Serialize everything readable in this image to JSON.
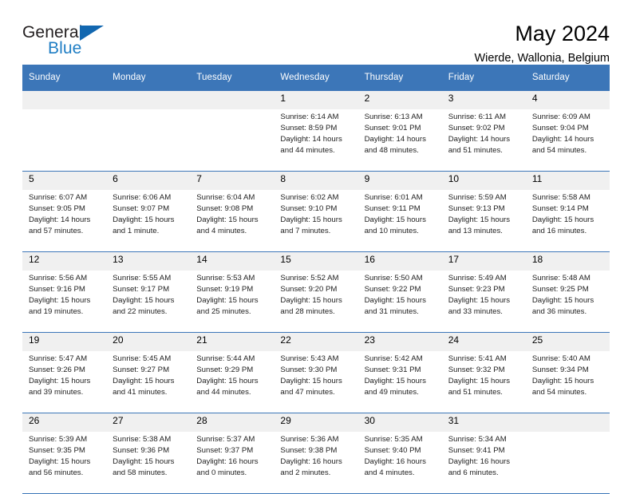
{
  "brand": {
    "name_part1": "General",
    "name_part2": "Blue",
    "logo_icon": "blue-triangle-icon"
  },
  "header": {
    "title": "May 2024",
    "subtitle": "Wierde, Wallonia, Belgium"
  },
  "theme": {
    "header_blue": "#3c76b8",
    "daynum_bg": "#f0f0f0",
    "brand_blue": "#1f7ec4",
    "text": "#000000"
  },
  "weekdays": [
    "Sunday",
    "Monday",
    "Tuesday",
    "Wednesday",
    "Thursday",
    "Friday",
    "Saturday"
  ],
  "weeks": [
    [
      {
        "day": "",
        "lines": []
      },
      {
        "day": "",
        "lines": []
      },
      {
        "day": "",
        "lines": []
      },
      {
        "day": "1",
        "lines": [
          "Sunrise: 6:14 AM",
          "Sunset: 8:59 PM",
          "Daylight: 14 hours",
          "and 44 minutes."
        ]
      },
      {
        "day": "2",
        "lines": [
          "Sunrise: 6:13 AM",
          "Sunset: 9:01 PM",
          "Daylight: 14 hours",
          "and 48 minutes."
        ]
      },
      {
        "day": "3",
        "lines": [
          "Sunrise: 6:11 AM",
          "Sunset: 9:02 PM",
          "Daylight: 14 hours",
          "and 51 minutes."
        ]
      },
      {
        "day": "4",
        "lines": [
          "Sunrise: 6:09 AM",
          "Sunset: 9:04 PM",
          "Daylight: 14 hours",
          "and 54 minutes."
        ]
      }
    ],
    [
      {
        "day": "5",
        "lines": [
          "Sunrise: 6:07 AM",
          "Sunset: 9:05 PM",
          "Daylight: 14 hours",
          "and 57 minutes."
        ]
      },
      {
        "day": "6",
        "lines": [
          "Sunrise: 6:06 AM",
          "Sunset: 9:07 PM",
          "Daylight: 15 hours",
          "and 1 minute."
        ]
      },
      {
        "day": "7",
        "lines": [
          "Sunrise: 6:04 AM",
          "Sunset: 9:08 PM",
          "Daylight: 15 hours",
          "and 4 minutes."
        ]
      },
      {
        "day": "8",
        "lines": [
          "Sunrise: 6:02 AM",
          "Sunset: 9:10 PM",
          "Daylight: 15 hours",
          "and 7 minutes."
        ]
      },
      {
        "day": "9",
        "lines": [
          "Sunrise: 6:01 AM",
          "Sunset: 9:11 PM",
          "Daylight: 15 hours",
          "and 10 minutes."
        ]
      },
      {
        "day": "10",
        "lines": [
          "Sunrise: 5:59 AM",
          "Sunset: 9:13 PM",
          "Daylight: 15 hours",
          "and 13 minutes."
        ]
      },
      {
        "day": "11",
        "lines": [
          "Sunrise: 5:58 AM",
          "Sunset: 9:14 PM",
          "Daylight: 15 hours",
          "and 16 minutes."
        ]
      }
    ],
    [
      {
        "day": "12",
        "lines": [
          "Sunrise: 5:56 AM",
          "Sunset: 9:16 PM",
          "Daylight: 15 hours",
          "and 19 minutes."
        ]
      },
      {
        "day": "13",
        "lines": [
          "Sunrise: 5:55 AM",
          "Sunset: 9:17 PM",
          "Daylight: 15 hours",
          "and 22 minutes."
        ]
      },
      {
        "day": "14",
        "lines": [
          "Sunrise: 5:53 AM",
          "Sunset: 9:19 PM",
          "Daylight: 15 hours",
          "and 25 minutes."
        ]
      },
      {
        "day": "15",
        "lines": [
          "Sunrise: 5:52 AM",
          "Sunset: 9:20 PM",
          "Daylight: 15 hours",
          "and 28 minutes."
        ]
      },
      {
        "day": "16",
        "lines": [
          "Sunrise: 5:50 AM",
          "Sunset: 9:22 PM",
          "Daylight: 15 hours",
          "and 31 minutes."
        ]
      },
      {
        "day": "17",
        "lines": [
          "Sunrise: 5:49 AM",
          "Sunset: 9:23 PM",
          "Daylight: 15 hours",
          "and 33 minutes."
        ]
      },
      {
        "day": "18",
        "lines": [
          "Sunrise: 5:48 AM",
          "Sunset: 9:25 PM",
          "Daylight: 15 hours",
          "and 36 minutes."
        ]
      }
    ],
    [
      {
        "day": "19",
        "lines": [
          "Sunrise: 5:47 AM",
          "Sunset: 9:26 PM",
          "Daylight: 15 hours",
          "and 39 minutes."
        ]
      },
      {
        "day": "20",
        "lines": [
          "Sunrise: 5:45 AM",
          "Sunset: 9:27 PM",
          "Daylight: 15 hours",
          "and 41 minutes."
        ]
      },
      {
        "day": "21",
        "lines": [
          "Sunrise: 5:44 AM",
          "Sunset: 9:29 PM",
          "Daylight: 15 hours",
          "and 44 minutes."
        ]
      },
      {
        "day": "22",
        "lines": [
          "Sunrise: 5:43 AM",
          "Sunset: 9:30 PM",
          "Daylight: 15 hours",
          "and 47 minutes."
        ]
      },
      {
        "day": "23",
        "lines": [
          "Sunrise: 5:42 AM",
          "Sunset: 9:31 PM",
          "Daylight: 15 hours",
          "and 49 minutes."
        ]
      },
      {
        "day": "24",
        "lines": [
          "Sunrise: 5:41 AM",
          "Sunset: 9:32 PM",
          "Daylight: 15 hours",
          "and 51 minutes."
        ]
      },
      {
        "day": "25",
        "lines": [
          "Sunrise: 5:40 AM",
          "Sunset: 9:34 PM",
          "Daylight: 15 hours",
          "and 54 minutes."
        ]
      }
    ],
    [
      {
        "day": "26",
        "lines": [
          "Sunrise: 5:39 AM",
          "Sunset: 9:35 PM",
          "Daylight: 15 hours",
          "and 56 minutes."
        ]
      },
      {
        "day": "27",
        "lines": [
          "Sunrise: 5:38 AM",
          "Sunset: 9:36 PM",
          "Daylight: 15 hours",
          "and 58 minutes."
        ]
      },
      {
        "day": "28",
        "lines": [
          "Sunrise: 5:37 AM",
          "Sunset: 9:37 PM",
          "Daylight: 16 hours",
          "and 0 minutes."
        ]
      },
      {
        "day": "29",
        "lines": [
          "Sunrise: 5:36 AM",
          "Sunset: 9:38 PM",
          "Daylight: 16 hours",
          "and 2 minutes."
        ]
      },
      {
        "day": "30",
        "lines": [
          "Sunrise: 5:35 AM",
          "Sunset: 9:40 PM",
          "Daylight: 16 hours",
          "and 4 minutes."
        ]
      },
      {
        "day": "31",
        "lines": [
          "Sunrise: 5:34 AM",
          "Sunset: 9:41 PM",
          "Daylight: 16 hours",
          "and 6 minutes."
        ]
      },
      {
        "day": "",
        "lines": []
      }
    ]
  ]
}
